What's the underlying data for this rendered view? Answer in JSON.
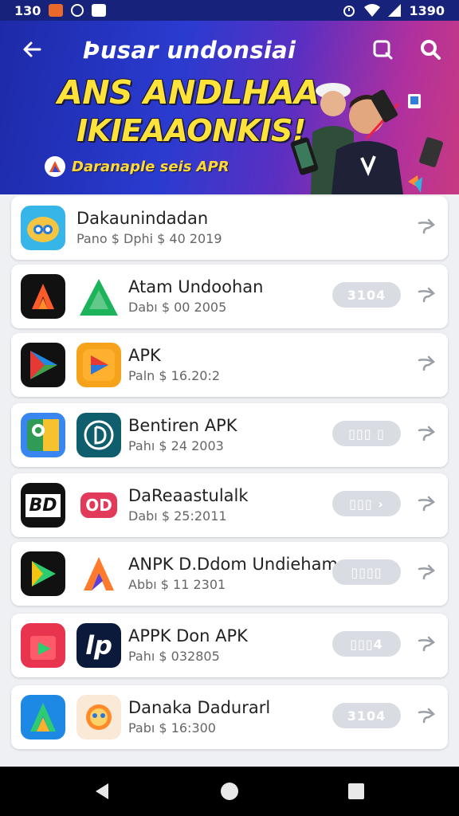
{
  "status_bar": {
    "time": "130",
    "right_time": "1390"
  },
  "header": {
    "title": "Þusar undonsiai",
    "headline_line1": "ANS ANDLHAA",
    "headline_line2": "IKIEAAONKIS!",
    "tagline": "Daranaple seis APR"
  },
  "apps": [
    {
      "name": "Dakaunindadan",
      "meta": "Pano $  Dphi $  40 2019",
      "pill": "",
      "single_icon": true
    },
    {
      "name": "Atam Undoohan",
      "meta": "Dabı $  00 2005",
      "pill": "3104"
    },
    {
      "name": "APK",
      "meta": "Paln $  16.20:2",
      "pill": ""
    },
    {
      "name": "Bentiren APK",
      "meta": "Pahı $  24 2003",
      "pill": "▯▯▯ ▯"
    },
    {
      "name": "DaReaastulalk",
      "meta": "Dabı $  25:2011",
      "pill": "▯▯▯ ›"
    },
    {
      "name": "ANPK D.Ddom Undieham",
      "meta": "Abbı $  11 2301",
      "pill": "▯▯▯▯"
    },
    {
      "name": "APPK Don APK",
      "meta": "Pahı $  032805",
      "pill": "▯▯▯4"
    },
    {
      "name": "Danaka Dadurarl",
      "meta": "Pabı $  16:300",
      "pill": "3104"
    }
  ],
  "icon_texts": {
    "bd_logo": "BD",
    "od_logo": "OD",
    "lp_logo": "lp"
  },
  "colors": {
    "hero_start": "#1d2aa8",
    "hero_end": "#c83a80",
    "headline": "#ffe23a",
    "pill": "#d9dde3"
  }
}
